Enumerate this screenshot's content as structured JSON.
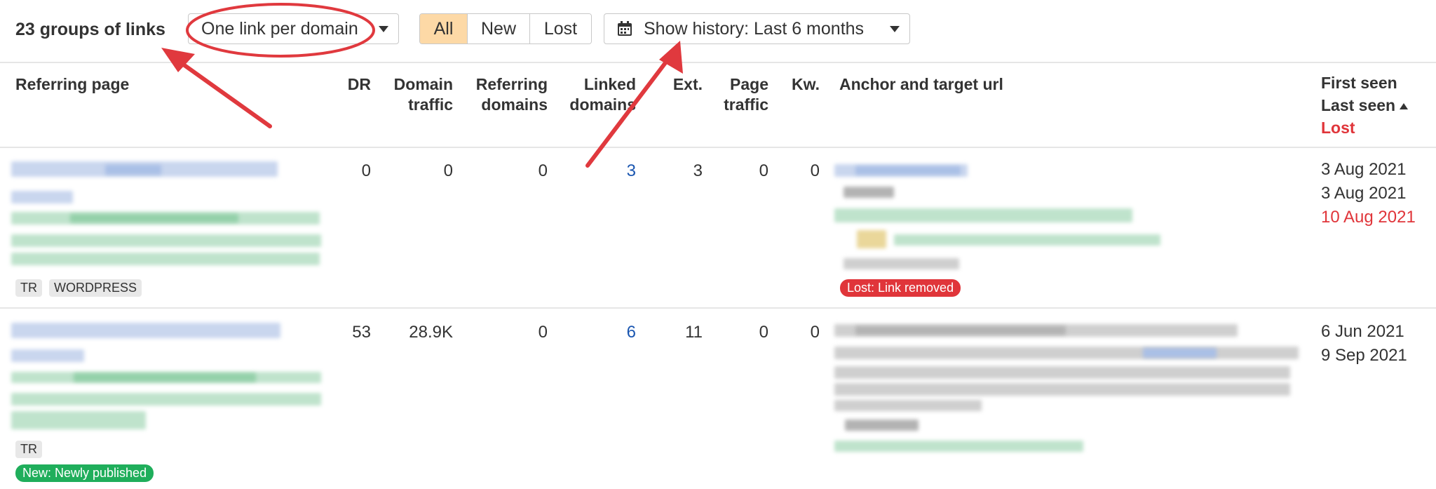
{
  "toolbar": {
    "groups_title": "23 groups of links",
    "domain_filter": "One link per domain",
    "segments": [
      "All",
      "New",
      "Lost"
    ],
    "active_segment": "All",
    "history_label": "Show history: Last 6 months"
  },
  "table": {
    "headers": {
      "referring_page": "Referring page",
      "dr": "DR",
      "domain_traffic_1": "Domain",
      "domain_traffic_2": "traffic",
      "referring_domains_1": "Referring",
      "referring_domains_2": "domains",
      "linked_domains_1": "Linked",
      "linked_domains_2": "domains",
      "ext": "Ext.",
      "page_traffic_1": "Page",
      "page_traffic_2": "traffic",
      "kw": "Kw.",
      "anchor": "Anchor and target url",
      "first_seen": "First seen",
      "last_seen": "Last seen",
      "lost": "Lost"
    },
    "rows": [
      {
        "dr": "0",
        "domain_traffic": "0",
        "referring_domains": "0",
        "linked_domains": "3",
        "ext": "3",
        "page_traffic": "0",
        "kw": "0",
        "tags": [
          "TR",
          "WORDPRESS"
        ],
        "status_badge": "Lost: Link removed",
        "first_seen": "3 Aug 2021",
        "last_seen": "3 Aug 2021",
        "lost": "10 Aug 2021"
      },
      {
        "dr": "53",
        "domain_traffic": "28.9K",
        "referring_domains": "0",
        "linked_domains": "6",
        "ext": "11",
        "page_traffic": "0",
        "kw": "0",
        "tags": [
          "TR"
        ],
        "status_badge": "New: Newly published",
        "first_seen": "6 Jun 2021",
        "last_seen": "9 Sep 2021"
      }
    ]
  },
  "colors": {
    "accent_segment": "#fdd9a6",
    "link": "#1a56b0",
    "lost": "#e0353a",
    "new": "#1fae5b",
    "annotation": "#e0393e"
  },
  "icons": {
    "caret": "caret-down-icon",
    "calendar": "calendar-icon",
    "sort": "sort-ascending-icon"
  }
}
